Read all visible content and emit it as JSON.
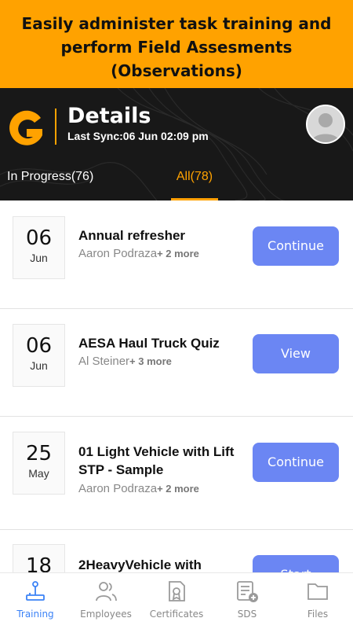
{
  "banner": {
    "text": "Easily administer task training and perform Field Assesments (Observations)"
  },
  "header": {
    "logo_letter": "G",
    "title": "Details",
    "last_sync": "Last Sync:06 Jun 02:09 pm",
    "avatar_icon": "user-avatar-icon"
  },
  "tabs": [
    {
      "label": "In Progress(76)",
      "active": false
    },
    {
      "label": "All(78)",
      "active": true
    }
  ],
  "items": [
    {
      "day": "06",
      "month": "Jun",
      "title": "Annual refresher",
      "assignee": "Aaron Podraza",
      "more": "+ 2 more",
      "action": "Continue"
    },
    {
      "day": "06",
      "month": "Jun",
      "title": "AESA Haul Truck Quiz",
      "assignee": "Al Steiner",
      "more": "+ 3 more",
      "action": "View"
    },
    {
      "day": "25",
      "month": "May",
      "title": "01 Light Vehicle with Lift STP - Sample",
      "assignee": "Aaron Podraza",
      "more": "+ 2 more",
      "action": "Continue"
    },
    {
      "day": "18",
      "month": "",
      "title": "2HeavyVehicle with",
      "assignee": "",
      "more": "",
      "action": "Start"
    }
  ],
  "bottom_nav": [
    {
      "label": "Training",
      "icon": "joystick-icon",
      "active": true
    },
    {
      "label": "Employees",
      "icon": "people-icon",
      "active": false
    },
    {
      "label": "Certificates",
      "icon": "certificate-icon",
      "active": false
    },
    {
      "label": "SDS",
      "icon": "sds-document-icon",
      "active": false
    },
    {
      "label": "Files",
      "icon": "folder-icon",
      "active": false
    }
  ],
  "colors": {
    "accent": "#ffa200",
    "header_bg": "#181818",
    "button": "#6b86f3",
    "nav_active": "#3b82f6"
  }
}
